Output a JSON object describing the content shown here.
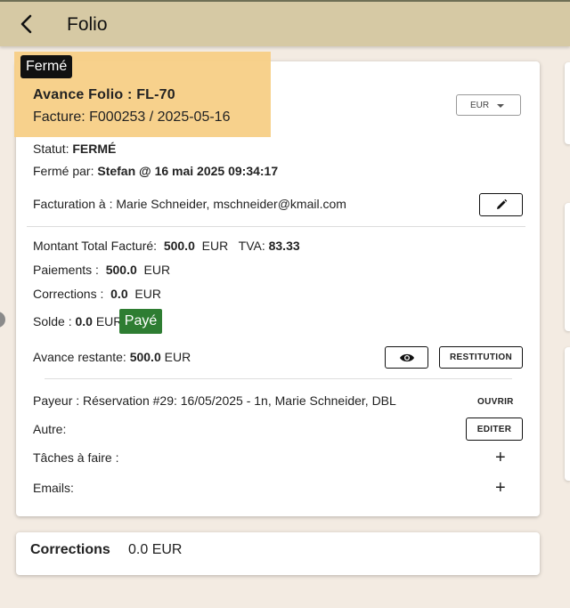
{
  "header": {
    "title": "Folio"
  },
  "folio": {
    "status_badge": "Fermé",
    "title": "Avance Folio : FL-70",
    "facture": "Facture: F000253 / 2025-05-16",
    "currency": "EUR",
    "statut_label": "Statut:",
    "statut_value": "FERMÉ",
    "ferme_label": "Fermé par:",
    "ferme_value": "Stefan @ 16 mai 2025 09:34:17",
    "facturation_label": "Facturation à :",
    "facturation_value": "Marie Schneider, mschneider@kmail.com",
    "montant_label": "Montant Total Facturé:",
    "montant_value": "500.0",
    "montant_currency": "EUR",
    "tva_label": "TVA:",
    "tva_value": "83.33",
    "paiements_label": "Paiements :",
    "paiements_value": "500.0",
    "paiements_currency": "EUR",
    "corrections_label": "Corrections :",
    "corrections_value": "0.0",
    "corrections_currency": "EUR",
    "solde_label": "Solde :",
    "solde_value": "0.0",
    "solde_currency": "EUR",
    "paye_badge": "Payé",
    "avance_label": "Avance restante:",
    "avance_value": "500.0",
    "avance_currency": "EUR",
    "restitution_button": "RESTITUTION",
    "payeur_label": "Payeur :",
    "payeur_value": "Réservation #29: 16/05/2025 - 1n, Marie Schneider, DBL",
    "ouvrir_button": "OUVRIR",
    "autre_label": "Autre:",
    "editer_button": "EDITER",
    "taches_label": "Tâches à faire :",
    "emails_label": "Emails:"
  },
  "corrections_card": {
    "title": "Corrections",
    "value": "0.0 EUR"
  },
  "icons": [
    "back-arrow-icon",
    "dropdown-caret-icon",
    "pencil-icon",
    "eye-icon",
    "plus-icon"
  ],
  "colors": {
    "header": "#d6c9a4",
    "background": "#f3ebe2",
    "highlight": "#f7cf86",
    "paid": "#2e7d32"
  }
}
